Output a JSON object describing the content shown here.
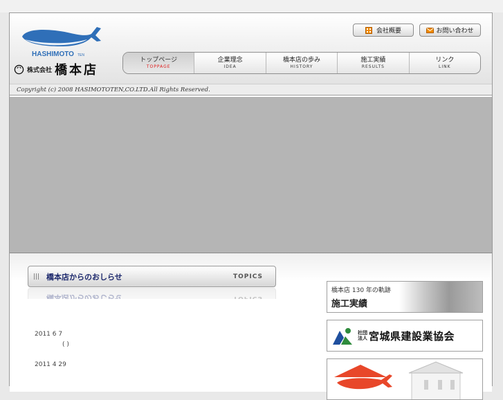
{
  "brand": {
    "logo_text": "HASHIMOTO",
    "logo_suffix": "TEN",
    "company_prefix": "株式会社",
    "company_name": "橋本店",
    "whale_color": "#2f6fb8"
  },
  "utility_buttons": [
    {
      "label": "会社概要",
      "icon": "building-icon"
    },
    {
      "label": "お問い合わせ",
      "icon": "mail-icon"
    }
  ],
  "nav": [
    {
      "jp": "トップページ",
      "en": "TOPPAGE",
      "active": true
    },
    {
      "jp": "企業理念",
      "en": "IDEA"
    },
    {
      "jp": "橋本店の歩み",
      "en": "HISTORY"
    },
    {
      "jp": "施工実績",
      "en": "RESULTS"
    },
    {
      "jp": "リンク",
      "en": "LINK"
    }
  ],
  "copyright": "Copyright (c) 2008 HASIMOTOTEN,CO.LTD.All Rights Reserved.",
  "topics": {
    "title": "橋本店からのおしらせ",
    "label_en": "TOPICS",
    "items": [
      {
        "date": "2011 6 7",
        "text": "(      )"
      },
      {
        "date": "2011 4 29",
        "text": ""
      }
    ]
  },
  "banners": {
    "history": {
      "top": "橋本店 130 年の軌跡",
      "main": "施工実績"
    },
    "association": {
      "prefix_line1": "社団",
      "prefix_line2": "法人",
      "name": "宮城県建設業協会"
    }
  },
  "colors": {
    "nav_active_en": "#e01818",
    "topics_title": "#1e2a6e",
    "association_green": "#2e8b3c",
    "association_blue": "#1f4f9e"
  }
}
